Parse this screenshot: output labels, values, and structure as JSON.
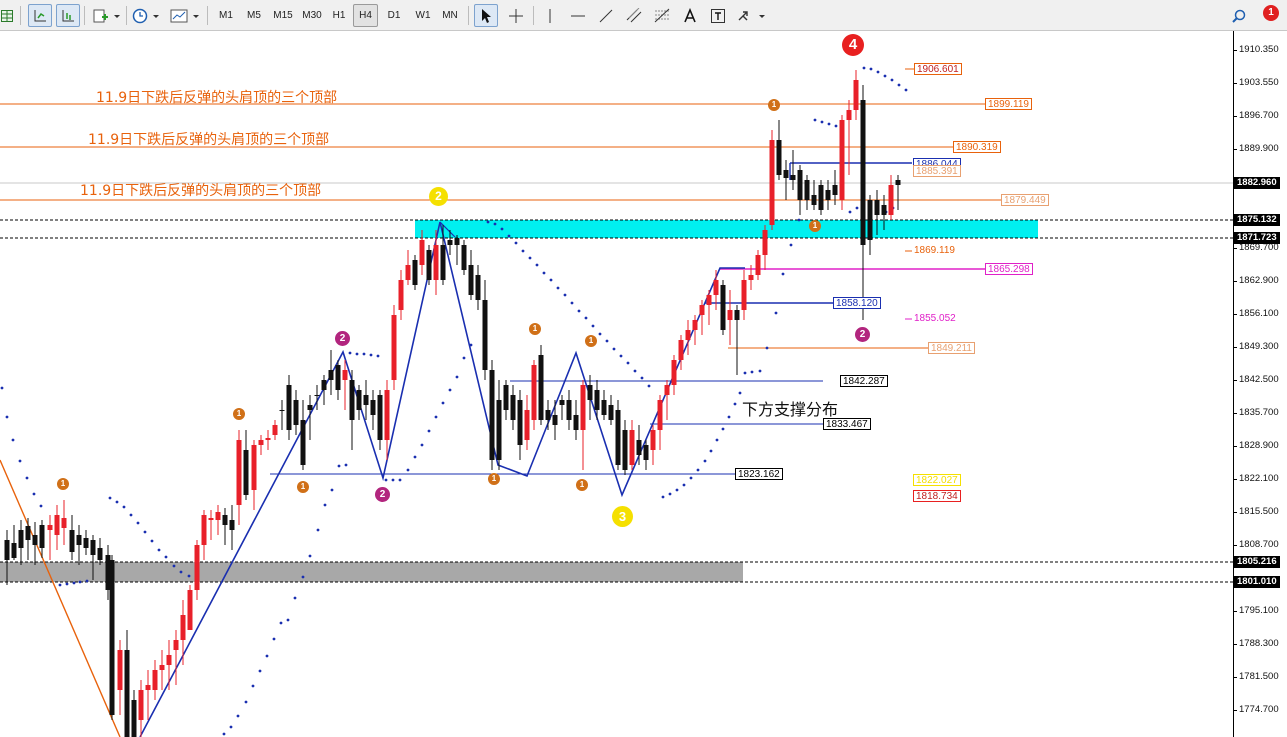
{
  "toolbar": {
    "timeframes": [
      "M1",
      "M5",
      "M15",
      "M30",
      "H1",
      "H4",
      "D1",
      "W1",
      "MN"
    ],
    "active_timeframe": "H4",
    "notification_count": "1"
  },
  "annotations": {
    "top_labels": [
      "11.9日下跌后反弹的头肩顶的三个顶部",
      "11.9日下跌后反弹的头肩顶的三个顶部",
      "11.9日下跌后反弹的头肩顶的三个顶部"
    ],
    "support_label": "下方支撑分布"
  },
  "price_labels": [
    "1906.601",
    "1899.119",
    "1890.319",
    "1886.044",
    "1885.391",
    "1879.449",
    "1869.119",
    "1865.298",
    "1858.120",
    "1855.052",
    "1849.211",
    "1842.287",
    "1833.467",
    "1823.162",
    "1822.027",
    "1818.734"
  ],
  "wave_markers": {
    "big_four": "4",
    "yellow_two": "2",
    "yellow_three": "3",
    "purple_two": "2",
    "orange_one": "1"
  },
  "price_axis": {
    "ticks": [
      "1910.350",
      "1903.550",
      "1896.700",
      "1889.900",
      "1882.960",
      "1875.132",
      "1869.700",
      "1862.900",
      "1856.100",
      "1849.300",
      "1842.500",
      "1835.700",
      "1828.900",
      "1822.100",
      "1815.500",
      "1808.700",
      "1805.216",
      "1801.010",
      "1795.100",
      "1788.300",
      "1781.500",
      "1774.700"
    ],
    "current_price": "1882.960",
    "highlighted": [
      "1875.132",
      "1871.723",
      "1805.216",
      "1801.010"
    ]
  },
  "colors": {
    "bull_candle": "#e8202a",
    "bear_candle": "#111111",
    "zigzag": "#1a2fb0",
    "sar_dots": "#1a2fb0",
    "resistance_zone": "#00f0f0",
    "support_zone": "#a8a8a8",
    "annotation_orange": "#e8620c",
    "magenta": "#e020c8",
    "wave_purple": "#b2257e",
    "wave_yellow": "#f5e000"
  }
}
